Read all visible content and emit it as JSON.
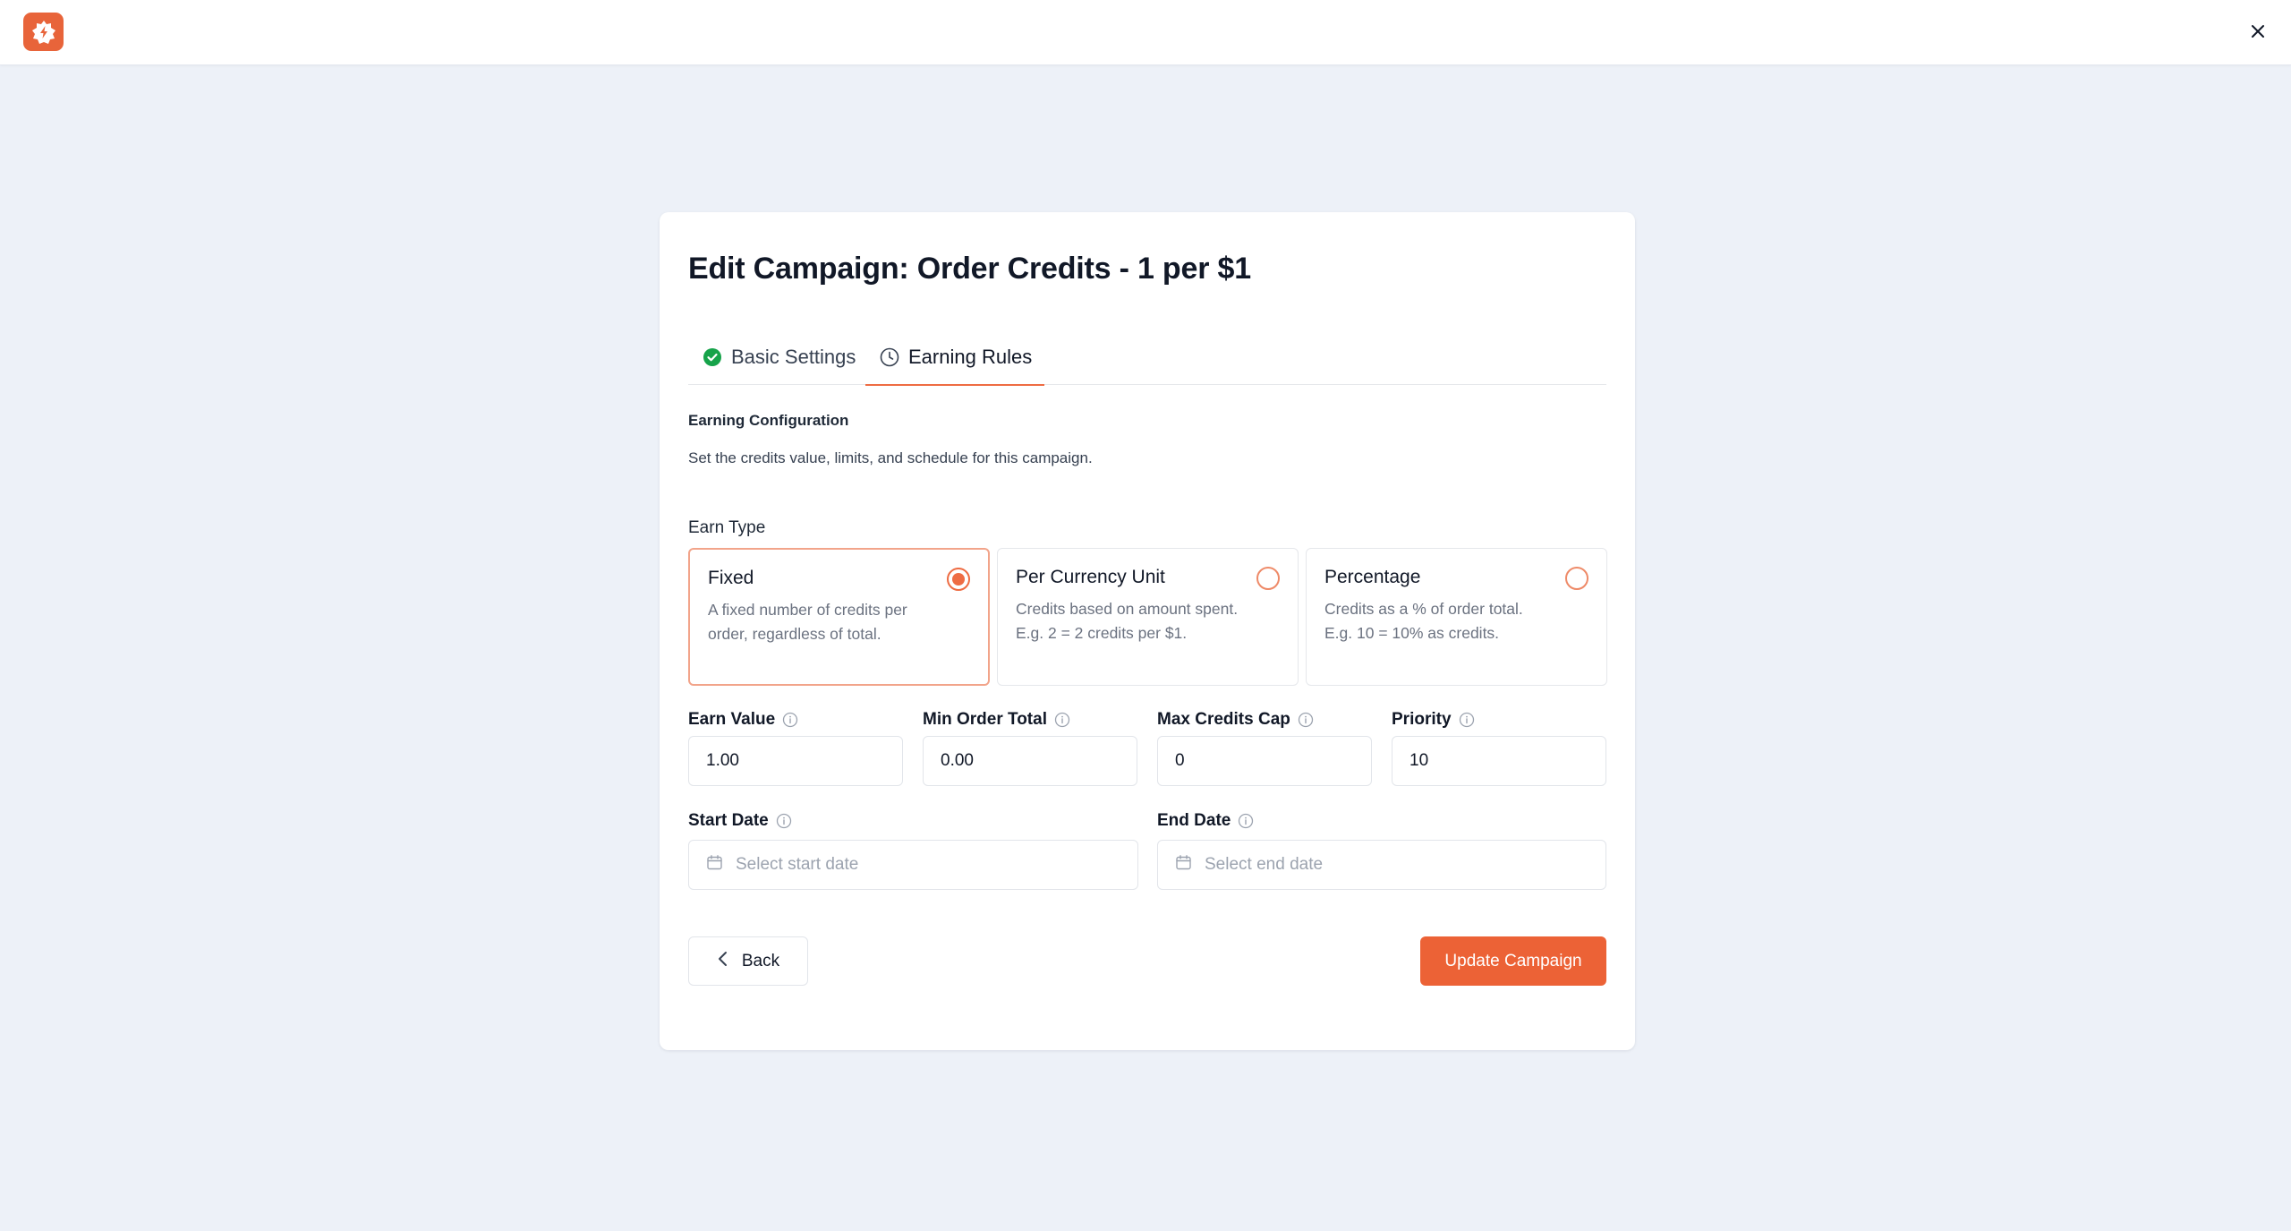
{
  "header": {
    "logo_icon": "app-logo-icon",
    "close_icon": "close-icon"
  },
  "page": {
    "title": "Edit Campaign: Order Credits - 1 per $1"
  },
  "tabs": [
    {
      "label": "Basic Settings",
      "icon": "check-circle-icon",
      "state": "completed"
    },
    {
      "label": "Earning Rules",
      "icon": "clock-icon",
      "state": "active"
    }
  ],
  "section": {
    "heading": "Earning Configuration",
    "description": "Set the credits value, limits, and schedule for this campaign."
  },
  "earn_type": {
    "label": "Earn Type",
    "options": [
      {
        "title": "Fixed",
        "description": "A fixed number of credits per order, regardless of total.",
        "selected": true
      },
      {
        "title": "Per Currency Unit",
        "description": "Credits based on amount spent. E.g. 2 = 2 credits per $1.",
        "selected": false
      },
      {
        "title": "Percentage",
        "description": "Credits as a % of order total. E.g. 10 = 10% as credits.",
        "selected": false
      }
    ]
  },
  "fields": {
    "earn_value": {
      "label": "Earn Value",
      "value": "1.00"
    },
    "min_order_total": {
      "label": "Min Order Total",
      "value": "0.00"
    },
    "max_credits_cap": {
      "label": "Max Credits Cap",
      "value": "0"
    },
    "priority": {
      "label": "Priority",
      "value": "10"
    },
    "start_date": {
      "label": "Start Date",
      "placeholder": "Select start date"
    },
    "end_date": {
      "label": "End Date",
      "placeholder": "Select end date"
    }
  },
  "actions": {
    "back_label": "Back",
    "update_label": "Update Campaign"
  },
  "colors": {
    "accent": "#ec6236",
    "success": "#16a34a",
    "background": "#edf1f8"
  }
}
